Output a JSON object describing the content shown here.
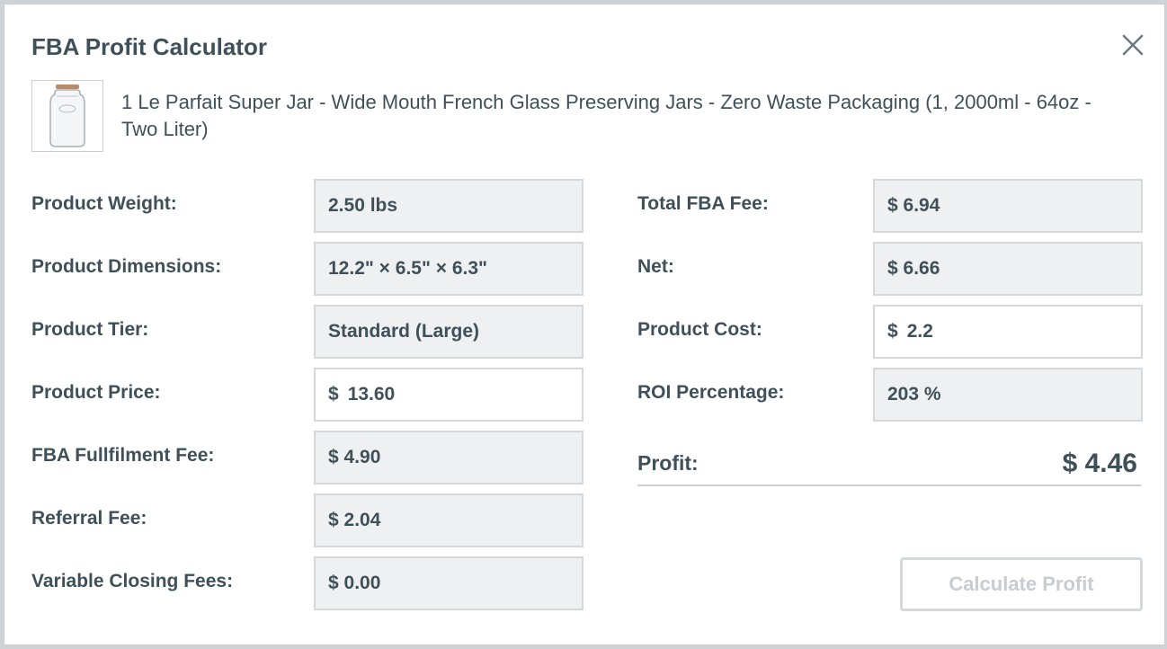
{
  "dialog": {
    "title": "FBA Profit Calculator",
    "close_icon": "close-icon"
  },
  "product": {
    "thumbnail_icon": "glass-jar-image",
    "name": "1 Le Parfait Super Jar - Wide Mouth French Glass Preserving Jars - Zero Waste Packaging (1, 2000ml - 64oz - Two Liter)"
  },
  "left_fields": {
    "weight": {
      "label": "Product Weight:",
      "value": "2.50 lbs"
    },
    "dimensions": {
      "label": "Product Dimensions:",
      "value": "12.2\" × 6.5\" × 6.3\""
    },
    "tier": {
      "label": "Product Tier:",
      "value": "Standard (Large)"
    },
    "price": {
      "label": "Product Price:",
      "currency": "$",
      "value": "13.60"
    },
    "fba_fee": {
      "label": "FBA Fullfilment Fee:",
      "value": "$ 4.90"
    },
    "referral_fee": {
      "label": "Referral Fee:",
      "value": "$ 2.04"
    },
    "closing_fees": {
      "label": "Variable Closing Fees:",
      "value": "$ 0.00"
    }
  },
  "right_fields": {
    "total_fba_fee": {
      "label": "Total FBA Fee:",
      "value": "$ 6.94"
    },
    "net": {
      "label": "Net:",
      "value": "$ 6.66"
    },
    "product_cost": {
      "label": "Product Cost:",
      "currency": "$",
      "value": "2.2"
    },
    "roi": {
      "label": "ROI Percentage:",
      "value": "203 %"
    }
  },
  "profit": {
    "label": "Profit:",
    "value": "$ 4.46"
  },
  "actions": {
    "calculate_label": "Calculate Profit"
  },
  "colors": {
    "text": "#3f5059",
    "readonly_bg": "#eef0f1",
    "border": "#d4d8db",
    "disabled_text": "#c7ccd0"
  }
}
